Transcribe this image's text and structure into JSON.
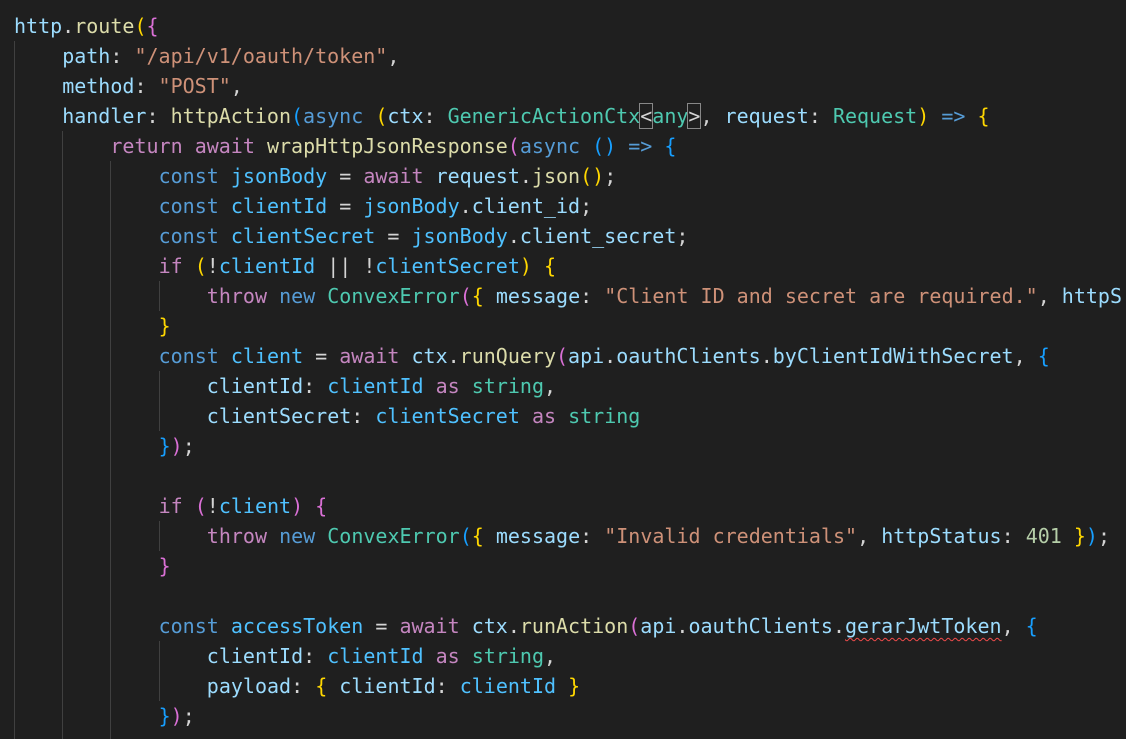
{
  "colors": {
    "background": "#1f1f1f",
    "plain": "#d4d4d4",
    "variable": "#9cdcfe",
    "constant": "#4fc1ff",
    "function": "#dcdcaa",
    "string": "#ce9178",
    "keyword": "#569cd6",
    "control_keyword": "#c586c0",
    "type": "#4ec9b0",
    "number": "#b5cea8",
    "bracket_1": "#ffd700",
    "bracket_2": "#da70d6",
    "bracket_3": "#179fff",
    "error_squiggle": "#f14c4c"
  },
  "code_lines": [
    {
      "indent": 0,
      "tokens": [
        {
          "t": "http",
          "c": "var"
        },
        {
          "t": ".",
          "c": "plain"
        },
        {
          "t": "route",
          "c": "fn"
        },
        {
          "t": "(",
          "c": "b1"
        },
        {
          "t": "{",
          "c": "b2"
        }
      ]
    },
    {
      "indent": 1,
      "tokens": [
        {
          "t": "path",
          "c": "var"
        },
        {
          "t": ": ",
          "c": "plain"
        },
        {
          "t": "\"/api/v1/oauth/token\"",
          "c": "str"
        },
        {
          "t": ",",
          "c": "plain"
        }
      ]
    },
    {
      "indent": 1,
      "tokens": [
        {
          "t": "method",
          "c": "var"
        },
        {
          "t": ": ",
          "c": "plain"
        },
        {
          "t": "\"POST\"",
          "c": "str"
        },
        {
          "t": ",",
          "c": "plain"
        }
      ]
    },
    {
      "indent": 1,
      "tokens": [
        {
          "t": "handler",
          "c": "var"
        },
        {
          "t": ": ",
          "c": "plain"
        },
        {
          "t": "httpAction",
          "c": "fn"
        },
        {
          "t": "(",
          "c": "b3"
        },
        {
          "t": "async",
          "c": "kw"
        },
        {
          "t": " ",
          "c": "plain"
        },
        {
          "t": "(",
          "c": "b1"
        },
        {
          "t": "ctx",
          "c": "var"
        },
        {
          "t": ": ",
          "c": "plain"
        },
        {
          "t": "GenericActionCtx",
          "c": "type"
        },
        {
          "t": "<",
          "c": "plain",
          "m": true
        },
        {
          "t": "any",
          "c": "type"
        },
        {
          "t": ">",
          "c": "plain",
          "m": true
        },
        {
          "t": ", ",
          "c": "plain"
        },
        {
          "t": "request",
          "c": "var"
        },
        {
          "t": ": ",
          "c": "plain"
        },
        {
          "t": "Request",
          "c": "type"
        },
        {
          "t": ")",
          "c": "b1"
        },
        {
          "t": " ",
          "c": "plain"
        },
        {
          "t": "=>",
          "c": "kw"
        },
        {
          "t": " ",
          "c": "plain"
        },
        {
          "t": "{",
          "c": "b1"
        }
      ]
    },
    {
      "indent": 2,
      "tokens": [
        {
          "t": "return",
          "c": "ctrl"
        },
        {
          "t": " ",
          "c": "plain"
        },
        {
          "t": "await",
          "c": "ctrl"
        },
        {
          "t": " ",
          "c": "plain"
        },
        {
          "t": "wrapHttpJsonResponse",
          "c": "fn"
        },
        {
          "t": "(",
          "c": "b2"
        },
        {
          "t": "async",
          "c": "kw"
        },
        {
          "t": " ",
          "c": "plain"
        },
        {
          "t": "()",
          "c": "b3"
        },
        {
          "t": " ",
          "c": "plain"
        },
        {
          "t": "=>",
          "c": "kw"
        },
        {
          "t": " ",
          "c": "plain"
        },
        {
          "t": "{",
          "c": "b3"
        }
      ]
    },
    {
      "indent": 3,
      "tokens": [
        {
          "t": "const",
          "c": "kw"
        },
        {
          "t": " ",
          "c": "plain"
        },
        {
          "t": "jsonBody",
          "c": "const"
        },
        {
          "t": " = ",
          "c": "plain"
        },
        {
          "t": "await",
          "c": "ctrl"
        },
        {
          "t": " ",
          "c": "plain"
        },
        {
          "t": "request",
          "c": "var"
        },
        {
          "t": ".",
          "c": "plain"
        },
        {
          "t": "json",
          "c": "fn"
        },
        {
          "t": "()",
          "c": "b1"
        },
        {
          "t": ";",
          "c": "plain"
        }
      ]
    },
    {
      "indent": 3,
      "tokens": [
        {
          "t": "const",
          "c": "kw"
        },
        {
          "t": " ",
          "c": "plain"
        },
        {
          "t": "clientId",
          "c": "const"
        },
        {
          "t": " = ",
          "c": "plain"
        },
        {
          "t": "jsonBody",
          "c": "const"
        },
        {
          "t": ".",
          "c": "plain"
        },
        {
          "t": "client_id",
          "c": "var"
        },
        {
          "t": ";",
          "c": "plain"
        }
      ]
    },
    {
      "indent": 3,
      "tokens": [
        {
          "t": "const",
          "c": "kw"
        },
        {
          "t": " ",
          "c": "plain"
        },
        {
          "t": "clientSecret",
          "c": "const"
        },
        {
          "t": " = ",
          "c": "plain"
        },
        {
          "t": "jsonBody",
          "c": "const"
        },
        {
          "t": ".",
          "c": "plain"
        },
        {
          "t": "client_secret",
          "c": "var"
        },
        {
          "t": ";",
          "c": "plain"
        }
      ]
    },
    {
      "indent": 3,
      "tokens": [
        {
          "t": "if",
          "c": "ctrl"
        },
        {
          "t": " ",
          "c": "plain"
        },
        {
          "t": "(",
          "c": "b1"
        },
        {
          "t": "!",
          "c": "plain"
        },
        {
          "t": "clientId",
          "c": "const"
        },
        {
          "t": " || ",
          "c": "plain"
        },
        {
          "t": "!",
          "c": "plain"
        },
        {
          "t": "clientSecret",
          "c": "const"
        },
        {
          "t": ")",
          "c": "b1"
        },
        {
          "t": " ",
          "c": "plain"
        },
        {
          "t": "{",
          "c": "b1"
        }
      ]
    },
    {
      "indent": 4,
      "tokens": [
        {
          "t": "throw",
          "c": "ctrl"
        },
        {
          "t": " ",
          "c": "plain"
        },
        {
          "t": "new",
          "c": "kw"
        },
        {
          "t": " ",
          "c": "plain"
        },
        {
          "t": "ConvexError",
          "c": "type"
        },
        {
          "t": "(",
          "c": "b2"
        },
        {
          "t": "{",
          "c": "b1"
        },
        {
          "t": " ",
          "c": "plain"
        },
        {
          "t": "message",
          "c": "var"
        },
        {
          "t": ": ",
          "c": "plain"
        },
        {
          "t": "\"Client ID and secret are required.\"",
          "c": "str"
        },
        {
          "t": ", ",
          "c": "plain"
        },
        {
          "t": "httpS",
          "c": "var"
        }
      ]
    },
    {
      "indent": 3,
      "tokens": [
        {
          "t": "}",
          "c": "b1"
        }
      ]
    },
    {
      "indent": 3,
      "tokens": [
        {
          "t": "const",
          "c": "kw"
        },
        {
          "t": " ",
          "c": "plain"
        },
        {
          "t": "client",
          "c": "const"
        },
        {
          "t": " = ",
          "c": "plain"
        },
        {
          "t": "await",
          "c": "ctrl"
        },
        {
          "t": " ",
          "c": "plain"
        },
        {
          "t": "ctx",
          "c": "var"
        },
        {
          "t": ".",
          "c": "plain"
        },
        {
          "t": "runQuery",
          "c": "fn"
        },
        {
          "t": "(",
          "c": "b2"
        },
        {
          "t": "api",
          "c": "var"
        },
        {
          "t": ".",
          "c": "plain"
        },
        {
          "t": "oauthClients",
          "c": "var"
        },
        {
          "t": ".",
          "c": "plain"
        },
        {
          "t": "byClientIdWithSecret",
          "c": "var"
        },
        {
          "t": ", ",
          "c": "plain"
        },
        {
          "t": "{",
          "c": "b3"
        }
      ]
    },
    {
      "indent": 4,
      "tokens": [
        {
          "t": "clientId",
          "c": "var"
        },
        {
          "t": ": ",
          "c": "plain"
        },
        {
          "t": "clientId",
          "c": "const"
        },
        {
          "t": " ",
          "c": "plain"
        },
        {
          "t": "as",
          "c": "ctrl"
        },
        {
          "t": " ",
          "c": "plain"
        },
        {
          "t": "string",
          "c": "type"
        },
        {
          "t": ",",
          "c": "plain"
        }
      ]
    },
    {
      "indent": 4,
      "tokens": [
        {
          "t": "clientSecret",
          "c": "var"
        },
        {
          "t": ": ",
          "c": "plain"
        },
        {
          "t": "clientSecret",
          "c": "const"
        },
        {
          "t": " ",
          "c": "plain"
        },
        {
          "t": "as",
          "c": "ctrl"
        },
        {
          "t": " ",
          "c": "plain"
        },
        {
          "t": "string",
          "c": "type"
        }
      ]
    },
    {
      "indent": 3,
      "tokens": [
        {
          "t": "}",
          "c": "b3"
        },
        {
          "t": ")",
          "c": "b2"
        },
        {
          "t": ";",
          "c": "plain"
        }
      ]
    },
    {
      "indent": 0,
      "tokens": []
    },
    {
      "indent": 3,
      "tokens": [
        {
          "t": "if",
          "c": "ctrl"
        },
        {
          "t": " ",
          "c": "plain"
        },
        {
          "t": "(",
          "c": "b2"
        },
        {
          "t": "!",
          "c": "plain"
        },
        {
          "t": "client",
          "c": "const"
        },
        {
          "t": ")",
          "c": "b2"
        },
        {
          "t": " ",
          "c": "plain"
        },
        {
          "t": "{",
          "c": "b2"
        }
      ]
    },
    {
      "indent": 4,
      "tokens": [
        {
          "t": "throw",
          "c": "ctrl"
        },
        {
          "t": " ",
          "c": "plain"
        },
        {
          "t": "new",
          "c": "kw"
        },
        {
          "t": " ",
          "c": "plain"
        },
        {
          "t": "ConvexError",
          "c": "type"
        },
        {
          "t": "(",
          "c": "b3"
        },
        {
          "t": "{",
          "c": "b1"
        },
        {
          "t": " ",
          "c": "plain"
        },
        {
          "t": "message",
          "c": "var"
        },
        {
          "t": ": ",
          "c": "plain"
        },
        {
          "t": "\"Invalid credentials\"",
          "c": "str"
        },
        {
          "t": ", ",
          "c": "plain"
        },
        {
          "t": "httpStatus",
          "c": "var"
        },
        {
          "t": ": ",
          "c": "plain"
        },
        {
          "t": "401",
          "c": "num"
        },
        {
          "t": " ",
          "c": "plain"
        },
        {
          "t": "}",
          "c": "b1"
        },
        {
          "t": ")",
          "c": "b3"
        },
        {
          "t": ";",
          "c": "plain"
        }
      ]
    },
    {
      "indent": 3,
      "tokens": [
        {
          "t": "}",
          "c": "b2"
        }
      ]
    },
    {
      "indent": 0,
      "tokens": []
    },
    {
      "indent": 3,
      "tokens": [
        {
          "t": "const",
          "c": "kw"
        },
        {
          "t": " ",
          "c": "plain"
        },
        {
          "t": "accessToken",
          "c": "const"
        },
        {
          "t": " = ",
          "c": "plain"
        },
        {
          "t": "await",
          "c": "ctrl"
        },
        {
          "t": " ",
          "c": "plain"
        },
        {
          "t": "ctx",
          "c": "var"
        },
        {
          "t": ".",
          "c": "plain"
        },
        {
          "t": "runAction",
          "c": "fn"
        },
        {
          "t": "(",
          "c": "b2"
        },
        {
          "t": "api",
          "c": "var"
        },
        {
          "t": ".",
          "c": "plain"
        },
        {
          "t": "oauthClients",
          "c": "var"
        },
        {
          "t": ".",
          "c": "plain"
        },
        {
          "t": "gerarJwtToken",
          "c": "var",
          "sq": true
        },
        {
          "t": ", ",
          "c": "plain"
        },
        {
          "t": "{",
          "c": "b3"
        }
      ]
    },
    {
      "indent": 4,
      "tokens": [
        {
          "t": "clientId",
          "c": "var"
        },
        {
          "t": ": ",
          "c": "plain"
        },
        {
          "t": "clientId",
          "c": "const"
        },
        {
          "t": " ",
          "c": "plain"
        },
        {
          "t": "as",
          "c": "ctrl"
        },
        {
          "t": " ",
          "c": "plain"
        },
        {
          "t": "string",
          "c": "type"
        },
        {
          "t": ",",
          "c": "plain"
        }
      ]
    },
    {
      "indent": 4,
      "tokens": [
        {
          "t": "payload",
          "c": "var"
        },
        {
          "t": ": ",
          "c": "plain"
        },
        {
          "t": "{",
          "c": "b1"
        },
        {
          "t": " ",
          "c": "plain"
        },
        {
          "t": "clientId",
          "c": "var"
        },
        {
          "t": ": ",
          "c": "plain"
        },
        {
          "t": "clientId",
          "c": "const"
        },
        {
          "t": " ",
          "c": "plain"
        },
        {
          "t": "}",
          "c": "b1"
        }
      ]
    },
    {
      "indent": 3,
      "tokens": [
        {
          "t": "}",
          "c": "b3"
        },
        {
          "t": ")",
          "c": "b2"
        },
        {
          "t": ";",
          "c": "plain"
        }
      ]
    }
  ]
}
